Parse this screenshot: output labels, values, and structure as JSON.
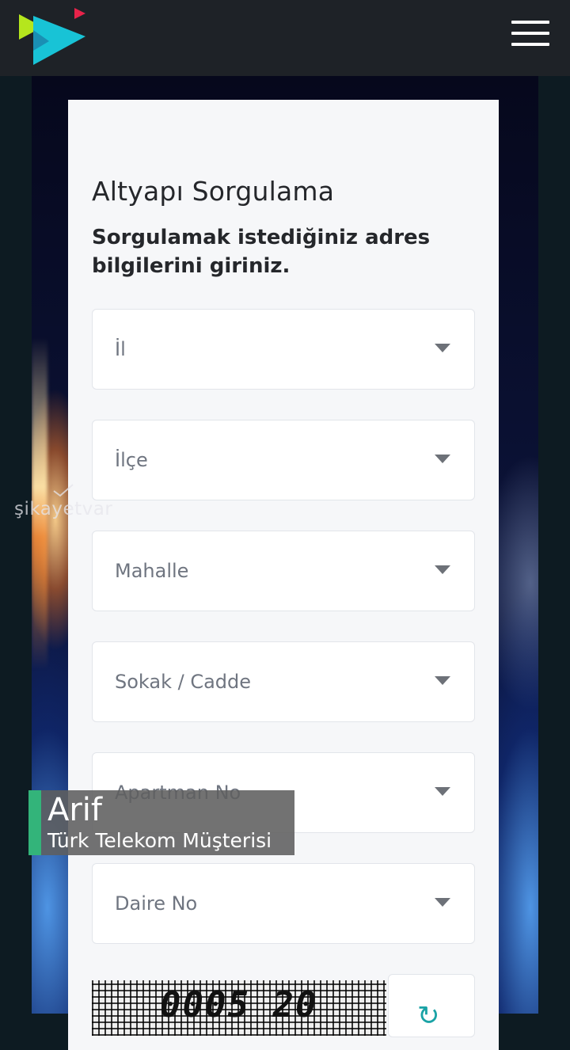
{
  "header": {
    "logo_icon": "play-arrows-logo-icon",
    "menu_icon": "hamburger-menu-icon"
  },
  "form": {
    "title": "Altyapı Sorgulama",
    "subtitle": "Sorgulamak istediğiniz adres bilgilerini giriniz.",
    "fields": [
      {
        "label": "İl"
      },
      {
        "label": "İlçe"
      },
      {
        "label": "Mahalle"
      },
      {
        "label": "Sokak / Cadde"
      },
      {
        "label": "Apartman No"
      },
      {
        "label": "Daire No"
      }
    ],
    "captcha_text": "0005 20",
    "refresh_icon": "refresh-icon"
  },
  "watermark": {
    "text": "şikayetvar"
  },
  "caption": {
    "name": "Arif",
    "role": "Türk Telekom Müşterisi"
  },
  "colors": {
    "topbar": "#1e2227",
    "card": "#f6f7f9",
    "caption_accent": "#33b47a",
    "logo_green": "#b5e61d",
    "logo_cyan": "#18c3d6",
    "logo_red": "#e8234a"
  }
}
